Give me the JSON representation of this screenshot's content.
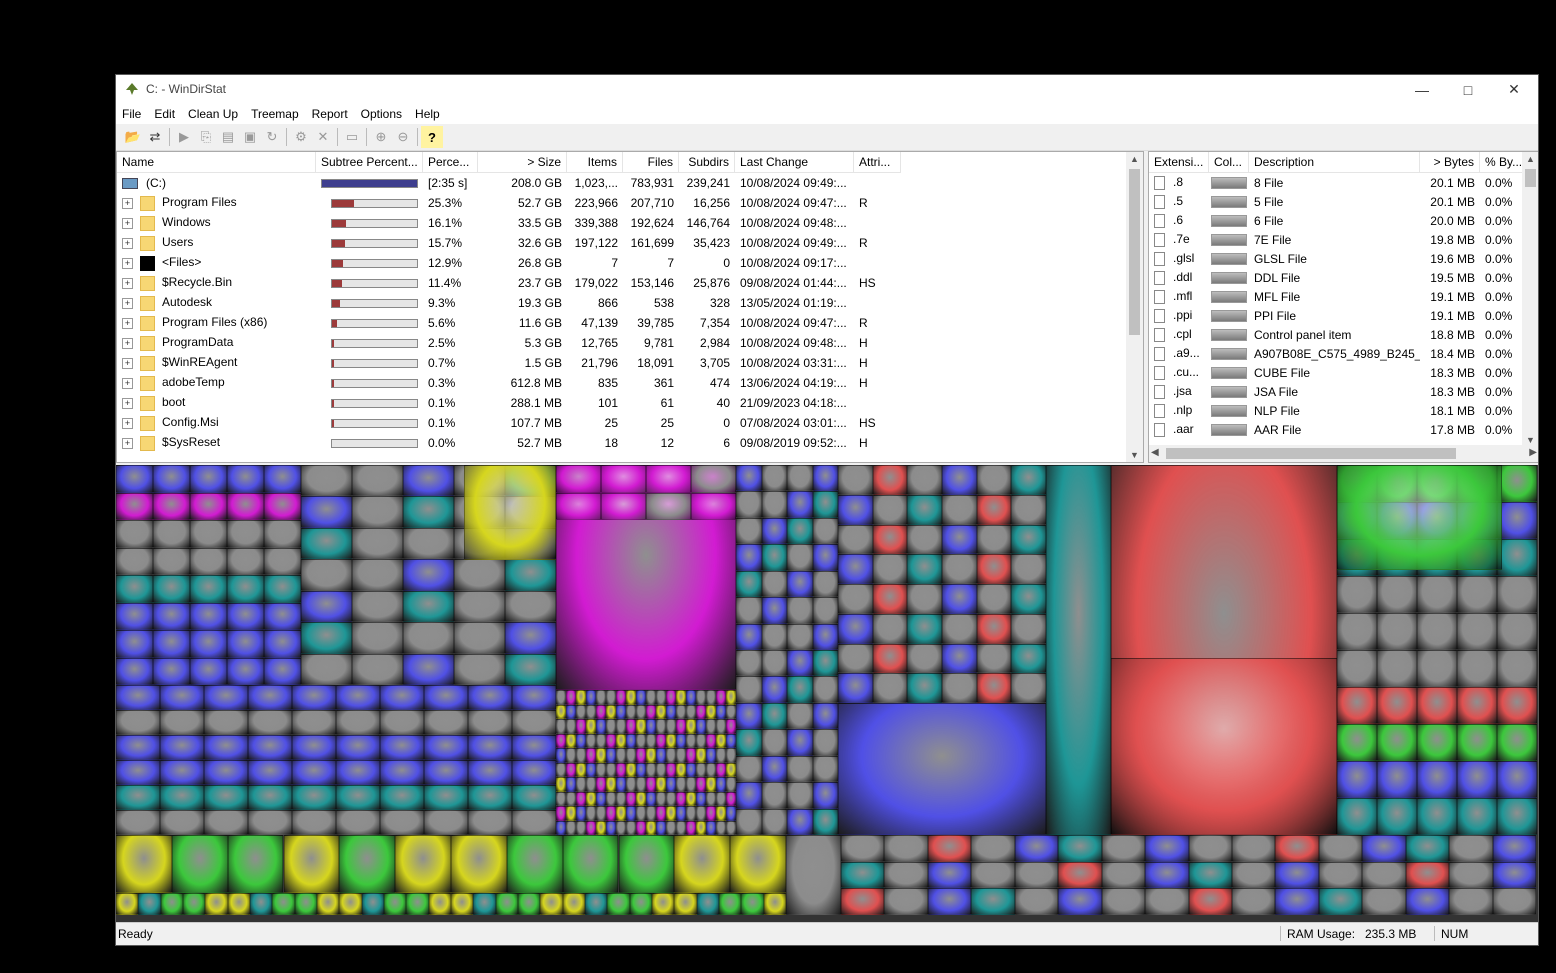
{
  "window": {
    "title": "C: - WinDirStat"
  },
  "menu": [
    "File",
    "Edit",
    "Clean Up",
    "Treemap",
    "Report",
    "Options",
    "Help"
  ],
  "toolbar_icons": [
    "open-icon",
    "refresh-icon",
    "play-icon",
    "copy-icon",
    "explorer-icon",
    "cmd-icon",
    "refresh-all-icon",
    "cleanup-icon",
    "delete-icon",
    "new-folder-icon",
    "zoom-in-icon",
    "zoom-out-icon",
    "help-icon"
  ],
  "tree": {
    "headers": [
      "Name",
      "Subtree Percent...",
      "Perce...",
      "> Size",
      "Items",
      "Files",
      "Subdirs",
      "Last Change",
      "Attri..."
    ],
    "rows": [
      {
        "name": "(C:)",
        "pct_bar": 1.0,
        "pct": "[2:35 s]",
        "size": "208.0 GB",
        "items": "1,023,...",
        "files": "783,931",
        "subdirs": "239,241",
        "changed": "10/08/2024 09:49:...",
        "attr": "",
        "root": true
      },
      {
        "name": "Program Files",
        "pct_bar": 0.253,
        "pct": "25.3%",
        "size": "52.7 GB",
        "items": "223,966",
        "files": "207,710",
        "subdirs": "16,256",
        "changed": "10/08/2024 09:47:...",
        "attr": "R"
      },
      {
        "name": "Windows",
        "pct_bar": 0.161,
        "pct": "16.1%",
        "size": "33.5 GB",
        "items": "339,388",
        "files": "192,624",
        "subdirs": "146,764",
        "changed": "10/08/2024 09:48:...",
        "attr": ""
      },
      {
        "name": "Users",
        "pct_bar": 0.157,
        "pct": "15.7%",
        "size": "32.6 GB",
        "items": "197,122",
        "files": "161,699",
        "subdirs": "35,423",
        "changed": "10/08/2024 09:49:...",
        "attr": "R"
      },
      {
        "name": "<Files>",
        "pct_bar": 0.129,
        "pct": "12.9%",
        "size": "26.8 GB",
        "items": "7",
        "files": "7",
        "subdirs": "0",
        "changed": "10/08/2024 09:17:...",
        "attr": "",
        "black": true
      },
      {
        "name": "$Recycle.Bin",
        "pct_bar": 0.114,
        "pct": "11.4%",
        "size": "23.7 GB",
        "items": "179,022",
        "files": "153,146",
        "subdirs": "25,876",
        "changed": "09/08/2024 01:44:...",
        "attr": "HS"
      },
      {
        "name": "Autodesk",
        "pct_bar": 0.093,
        "pct": "9.3%",
        "size": "19.3 GB",
        "items": "866",
        "files": "538",
        "subdirs": "328",
        "changed": "13/05/2024 01:19:...",
        "attr": ""
      },
      {
        "name": "Program Files (x86)",
        "pct_bar": 0.056,
        "pct": "5.6%",
        "size": "11.6 GB",
        "items": "47,139",
        "files": "39,785",
        "subdirs": "7,354",
        "changed": "10/08/2024 09:47:...",
        "attr": "R"
      },
      {
        "name": "ProgramData",
        "pct_bar": 0.025,
        "pct": "2.5%",
        "size": "5.3 GB",
        "items": "12,765",
        "files": "9,781",
        "subdirs": "2,984",
        "changed": "10/08/2024 09:48:...",
        "attr": "H"
      },
      {
        "name": "$WinREAgent",
        "pct_bar": 0.007,
        "pct": "0.7%",
        "size": "1.5 GB",
        "items": "21,796",
        "files": "18,091",
        "subdirs": "3,705",
        "changed": "10/08/2024 03:31:...",
        "attr": "H"
      },
      {
        "name": "adobeTemp",
        "pct_bar": 0.003,
        "pct": "0.3%",
        "size": "612.8 MB",
        "items": "835",
        "files": "361",
        "subdirs": "474",
        "changed": "13/06/2024 04:19:...",
        "attr": "H"
      },
      {
        "name": "boot",
        "pct_bar": 0.001,
        "pct": "0.1%",
        "size": "288.1 MB",
        "items": "101",
        "files": "61",
        "subdirs": "40",
        "changed": "21/09/2023 04:18:...",
        "attr": ""
      },
      {
        "name": "Config.Msi",
        "pct_bar": 0.001,
        "pct": "0.1%",
        "size": "107.7 MB",
        "items": "25",
        "files": "25",
        "subdirs": "0",
        "changed": "07/08/2024 03:01:...",
        "attr": "HS"
      },
      {
        "name": "$SysReset",
        "pct_bar": 0.0,
        "pct": "0.0%",
        "size": "52.7 MB",
        "items": "18",
        "files": "12",
        "subdirs": "6",
        "changed": "09/08/2019 09:52:...",
        "attr": "H"
      }
    ]
  },
  "extensions": {
    "headers": [
      "Extensi...",
      "Col...",
      "Description",
      "> Bytes",
      "% By..."
    ],
    "rows": [
      {
        "ext": ".8",
        "desc": "8 File",
        "bytes": "20.1 MB",
        "pct": "0.0%"
      },
      {
        "ext": ".5",
        "desc": "5 File",
        "bytes": "20.1 MB",
        "pct": "0.0%"
      },
      {
        "ext": ".6",
        "desc": "6 File",
        "bytes": "20.0 MB",
        "pct": "0.0%"
      },
      {
        "ext": ".7e",
        "desc": "7E File",
        "bytes": "19.8 MB",
        "pct": "0.0%"
      },
      {
        "ext": ".glsl",
        "desc": "GLSL File",
        "bytes": "19.6 MB",
        "pct": "0.0%"
      },
      {
        "ext": ".ddl",
        "desc": "DDL File",
        "bytes": "19.5 MB",
        "pct": "0.0%"
      },
      {
        "ext": ".mfl",
        "desc": "MFL File",
        "bytes": "19.1 MB",
        "pct": "0.0%"
      },
      {
        "ext": ".ppi",
        "desc": "PPI File",
        "bytes": "19.1 MB",
        "pct": "0.0%"
      },
      {
        "ext": ".cpl",
        "desc": "Control panel item",
        "bytes": "18.8 MB",
        "pct": "0.0%"
      },
      {
        "ext": ".a9...",
        "desc": "A907B08E_C575_4989_B245_...",
        "bytes": "18.4 MB",
        "pct": "0.0%"
      },
      {
        "ext": ".cu...",
        "desc": "CUBE File",
        "bytes": "18.3 MB",
        "pct": "0.0%"
      },
      {
        "ext": ".jsa",
        "desc": "JSA File",
        "bytes": "18.3 MB",
        "pct": "0.0%"
      },
      {
        "ext": ".nlp",
        "desc": "NLP File",
        "bytes": "18.1 MB",
        "pct": "0.0%"
      },
      {
        "ext": ".aar",
        "desc": "AAR File",
        "bytes": "17.8 MB",
        "pct": "0.0%"
      }
    ]
  },
  "status": {
    "ready": "Ready",
    "ram_label": "RAM Usage:",
    "ram_value": "235.3 MB",
    "num": "NUM"
  },
  "colors": {
    "magenta": "#d21bd2",
    "blue": "#5050e6",
    "red": "#e05050",
    "green": "#3cc83c",
    "yellow": "#d6d61e",
    "teal": "#1e9696",
    "gray": "#8c8c8c"
  }
}
